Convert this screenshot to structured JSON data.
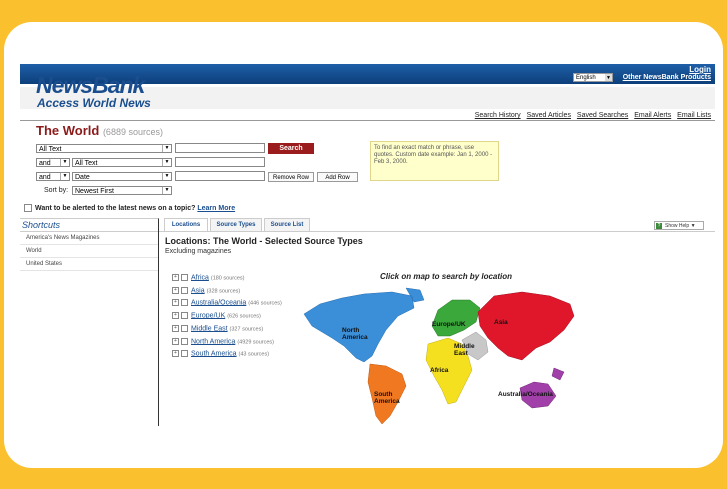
{
  "header": {
    "logo": "NewsBank",
    "logo_mark": "®",
    "tagline": "Access World News",
    "login": "Login",
    "language": "English",
    "other_products": "Other NewsBank Products"
  },
  "top_links": [
    "Search History",
    "Saved Articles",
    "Saved Searches",
    "Email Alerts",
    "Email Lists"
  ],
  "page": {
    "title": "The World",
    "source_count": "(6889 sources)"
  },
  "search": {
    "row1_field": "All Text",
    "row2_op": "and",
    "row2_field": "All Text",
    "row3_op": "and",
    "row3_field": "Date",
    "search_button": "Search",
    "remove_row": "Remove Row",
    "add_row": "Add Row",
    "sort_label": "Sort by:",
    "sort_value": "Newest First",
    "hint": "To find an exact match or phrase, use quotes. Custom date example: Jan 1, 2000 - Feb 3, 2000."
  },
  "alert": {
    "text": "Want to be alerted to the latest news on a topic?",
    "link": "Learn More"
  },
  "sidebar": {
    "title": "Shortcuts",
    "items": [
      "America's News Magazines",
      "World",
      "United States"
    ]
  },
  "tabs": [
    "Locations",
    "Source Types",
    "Source List"
  ],
  "show_help": "Show Help",
  "locations": {
    "title": "Locations: The World - Selected Source Types",
    "subtitle": "Excluding magazines",
    "map_prompt": "Click on map to search by location",
    "regions": [
      {
        "name": "Africa",
        "count": "(180 sources)"
      },
      {
        "name": "Asia",
        "count": "(328 sources)"
      },
      {
        "name": "Australia/Oceania",
        "count": "(446 sources)"
      },
      {
        "name": "Europe/UK",
        "count": "(626 sources)"
      },
      {
        "name": "Middle East",
        "count": "(327 sources)"
      },
      {
        "name": "North America",
        "count": "(4929 sources)"
      },
      {
        "name": "South America",
        "count": "(43 sources)"
      }
    ]
  },
  "map_labels": {
    "north_america": "North America",
    "south_america": "South America",
    "europe": "Europe/UK",
    "africa": "Africa",
    "middle_east": "Middle East",
    "asia": "Asia",
    "oceania": "Australia/Oceania"
  },
  "colors": {
    "frame": "#fbc02d",
    "brand_blue": "#1a4e8e",
    "search_red": "#9b1c1c",
    "north_america": "#3a8fd8",
    "south_america": "#f07820",
    "europe": "#3aa83a",
    "africa": "#f5e020",
    "middle_east": "#c8c8c8",
    "asia": "#e0162b",
    "oceania": "#a040a8"
  }
}
